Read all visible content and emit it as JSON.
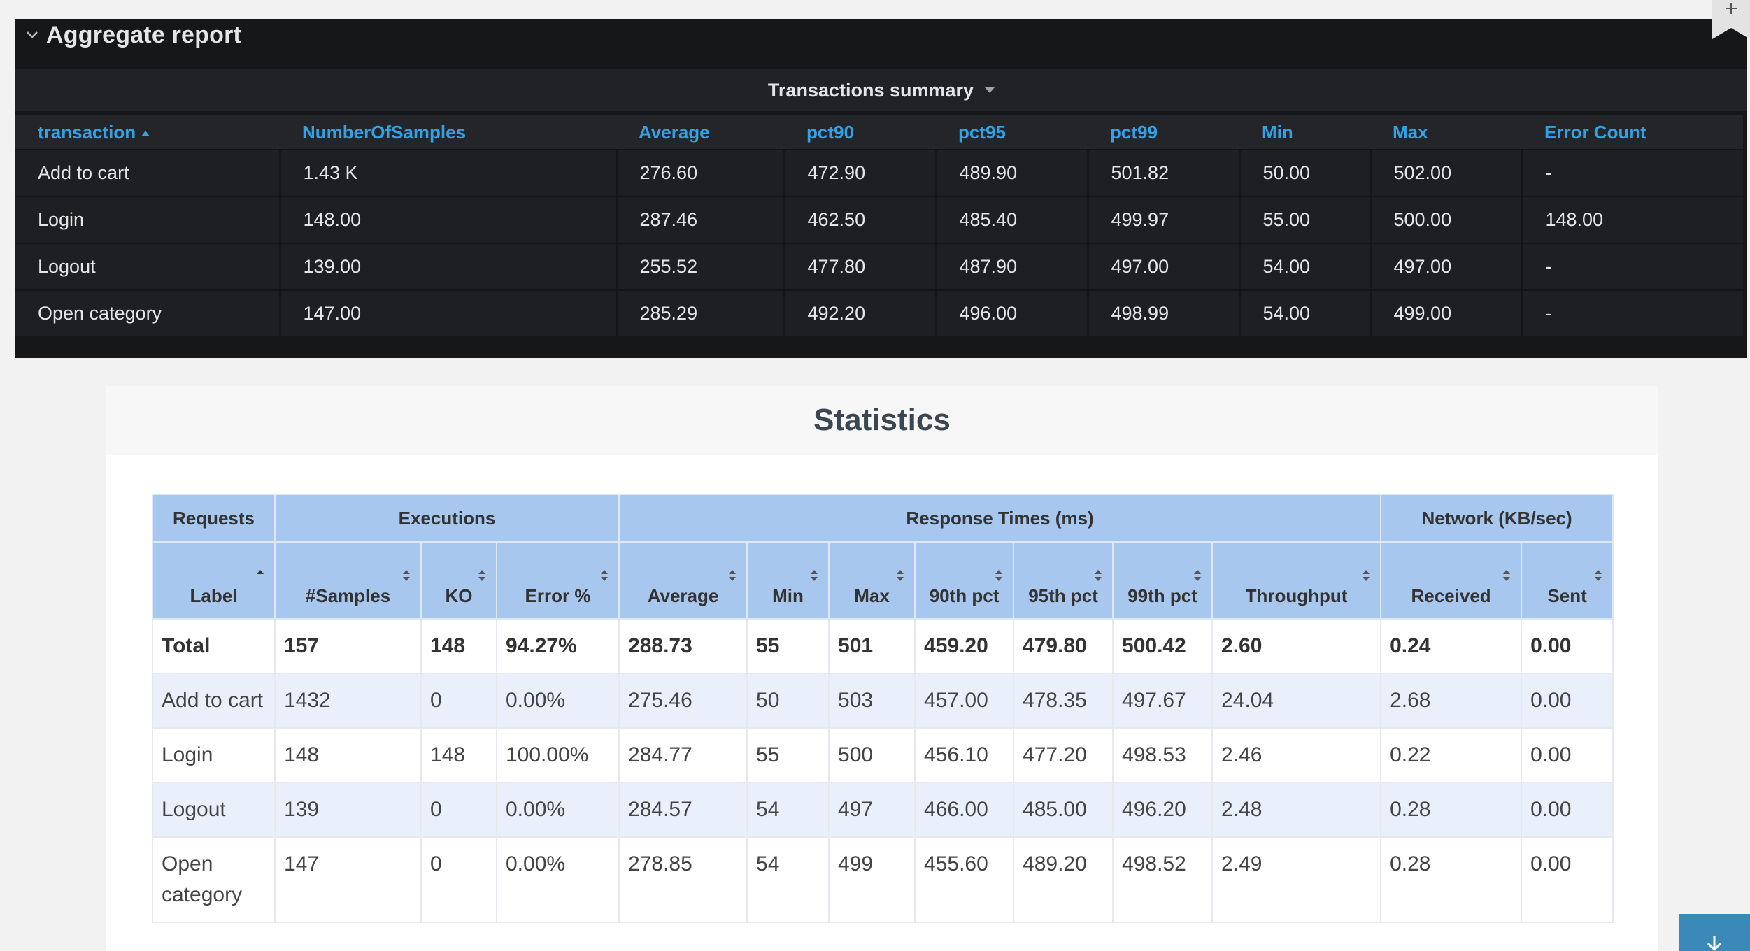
{
  "grafana": {
    "title": "Aggregate report",
    "subheader": "Transactions summary",
    "headers": [
      "transaction",
      "NumberOfSamples",
      "Average",
      "pct90",
      "pct95",
      "pct99",
      "Min",
      "Max",
      "Error Count"
    ],
    "rows": [
      [
        "Add to cart",
        "1.43 K",
        "276.60",
        "472.90",
        "489.90",
        "501.82",
        "50.00",
        "502.00",
        "-"
      ],
      [
        "Login",
        "148.00",
        "287.46",
        "462.50",
        "485.40",
        "499.97",
        "55.00",
        "500.00",
        "148.00"
      ],
      [
        "Logout",
        "139.00",
        "255.52",
        "477.80",
        "487.90",
        "497.00",
        "54.00",
        "497.00",
        "-"
      ],
      [
        "Open category",
        "147.00",
        "285.29",
        "492.20",
        "496.00",
        "498.99",
        "54.00",
        "499.00",
        "-"
      ]
    ],
    "colors": {
      "background": "#161719",
      "header_text": "#33a2e5"
    }
  },
  "statistics": {
    "title": "Statistics",
    "groups": [
      "Requests",
      "Executions",
      "Response Times (ms)",
      "Network (KB/sec)"
    ],
    "columns": [
      "Label",
      "#Samples",
      "KO",
      "Error %",
      "Average",
      "Min",
      "Max",
      "90th pct",
      "95th pct",
      "99th pct",
      "Throughput",
      "Received",
      "Sent"
    ],
    "rows": [
      [
        "Total",
        "157",
        "148",
        "94.27%",
        "288.73",
        "55",
        "501",
        "459.20",
        "479.80",
        "500.42",
        "2.60",
        "0.24",
        "0.00"
      ],
      [
        "Add to cart",
        "1432",
        "0",
        "0.00%",
        "275.46",
        "50",
        "503",
        "457.00",
        "478.35",
        "497.67",
        "24.04",
        "2.68",
        "0.00"
      ],
      [
        "Login",
        "148",
        "148",
        "100.00%",
        "284.77",
        "55",
        "500",
        "456.10",
        "477.20",
        "498.53",
        "2.46",
        "0.22",
        "0.00"
      ],
      [
        "Logout",
        "139",
        "0",
        "0.00%",
        "284.57",
        "54",
        "497",
        "466.00",
        "485.00",
        "496.20",
        "2.48",
        "0.28",
        "0.00"
      ],
      [
        "Open category",
        "147",
        "0",
        "0.00%",
        "278.85",
        "54",
        "499",
        "455.60",
        "489.20",
        "498.52",
        "2.49",
        "0.28",
        "0.00"
      ]
    ],
    "colors": {
      "header_bg": "#a8c7ee",
      "stripe": "#e9f0fb"
    }
  }
}
